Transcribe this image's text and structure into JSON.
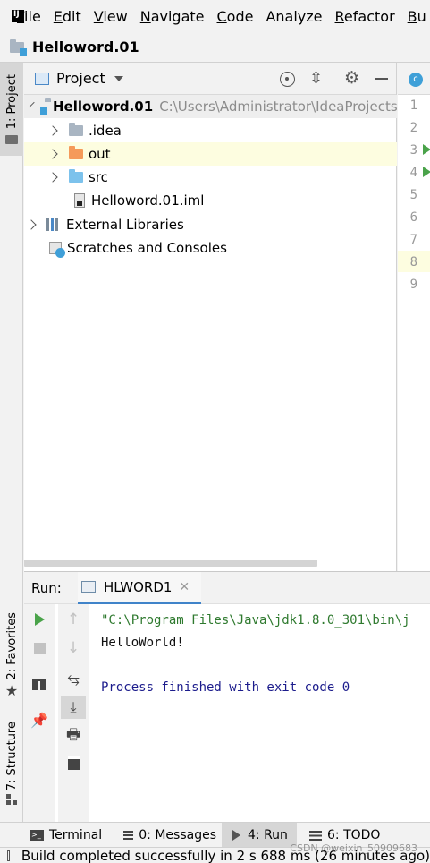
{
  "menubar": {
    "items": [
      {
        "label": "File",
        "mnemonic": "F",
        "rest": "ile"
      },
      {
        "label": "Edit",
        "mnemonic": "E",
        "rest": "dit"
      },
      {
        "label": "View",
        "mnemonic": "V",
        "rest": "iew"
      },
      {
        "label": "Navigate",
        "mnemonic": "N",
        "rest": "avigate"
      },
      {
        "label": "Code",
        "mnemonic": "C",
        "rest": "ode"
      },
      {
        "label": "Analyze",
        "mnemonic": "",
        "rest": "Analyze"
      },
      {
        "label": "Refactor",
        "mnemonic": "R",
        "rest": "efactor"
      },
      {
        "label": "Bu",
        "mnemonic": "B",
        "rest": "u"
      }
    ]
  },
  "navbar": {
    "project_name": "Helloword.01"
  },
  "left_strip": {
    "project_tab": "1: Project",
    "favorites_tab": "2: Favorites",
    "structure_tab": "7: Structure"
  },
  "project_panel": {
    "title": "Project",
    "tree": {
      "root_name": "Helloword.01",
      "root_path": "C:\\Users\\Administrator\\IdeaProjects",
      "items": [
        {
          "label": ".idea"
        },
        {
          "label": "out"
        },
        {
          "label": "src"
        },
        {
          "label": "Helloword.01.iml"
        }
      ],
      "external_libraries": "External Libraries",
      "scratches": "Scratches and Consoles"
    }
  },
  "editor": {
    "line_numbers": [
      "1",
      "2",
      "3",
      "4",
      "5",
      "6",
      "7",
      "8",
      "9"
    ]
  },
  "run_panel": {
    "label": "Run:",
    "tab_name": "HLWORD1",
    "console": {
      "command": "\"C:\\Program Files\\Java\\jdk1.8.0_301\\bin\\j",
      "output": "HelloWorld!",
      "exit_message": "Process finished with exit code 0"
    }
  },
  "bottom_tabs": {
    "terminal": "Terminal",
    "messages": "0: Messages",
    "run": "4: Run",
    "todo": "6: TODO"
  },
  "statusbar": {
    "message": "Build completed successfully in 2 s 688 ms (26 minutes ago)"
  },
  "watermark": "CSDN @weixin_50909683",
  "colors": {
    "selection_row": "#fdfde0",
    "console_command": "#2f7a2f",
    "console_exit": "#1c1c8c",
    "run_green": "#4aa34a",
    "out_folder": "#f59a5a",
    "src_folder": "#7cc2ec"
  }
}
